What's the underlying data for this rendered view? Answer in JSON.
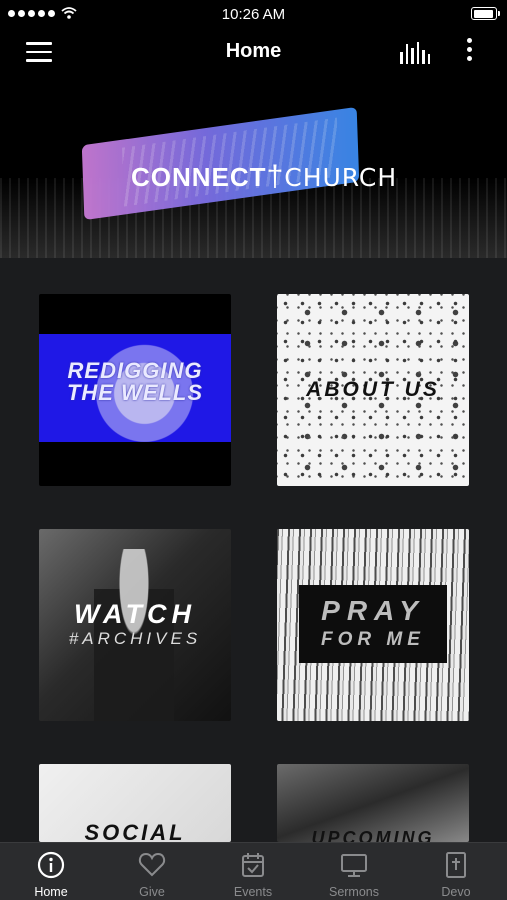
{
  "status_bar": {
    "time": "10:26 AM"
  },
  "nav": {
    "title": "Home"
  },
  "hero": {
    "logo_bold": "CONNECT",
    "logo_light": "CHURCH"
  },
  "tiles": {
    "redigging": {
      "line1": "REDIGGING",
      "line2": "THE WELLS"
    },
    "about": {
      "label": "ABOUT US"
    },
    "watch": {
      "title": "WATCH",
      "subtitle": "#ARCHIVES"
    },
    "pray": {
      "title": "PRAY",
      "subtitle": "FOR ME"
    },
    "social": {
      "label": "SOCIAL"
    },
    "upcoming": {
      "label": "UPCOMING"
    }
  },
  "tab_bar": {
    "tabs": [
      {
        "label": "Home",
        "icon": "info-circle-icon",
        "active": true
      },
      {
        "label": "Give",
        "icon": "heart-icon"
      },
      {
        "label": "Events",
        "icon": "calendar-check-icon"
      },
      {
        "label": "Sermons",
        "icon": "monitor-icon"
      },
      {
        "label": "Devo",
        "icon": "bible-cross-icon"
      }
    ]
  },
  "colors": {
    "tab_bar_bg": "#2b2c2e",
    "active_tab": "#ffffff",
    "inactive_tab": "#8a8b8d",
    "page_bg": "#1b1c1e"
  }
}
